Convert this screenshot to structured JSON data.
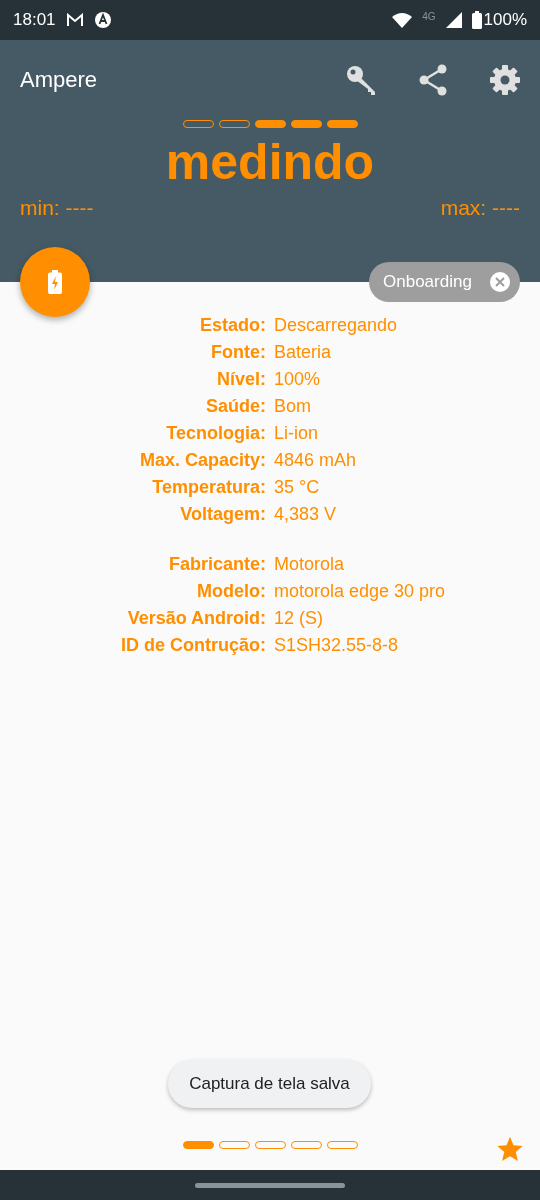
{
  "status_bar": {
    "time": "18:01",
    "network": "4G",
    "battery": "100%"
  },
  "app_bar": {
    "title": "Ampere"
  },
  "meter": {
    "segments": [
      {
        "on": false
      },
      {
        "on": false
      },
      {
        "on": true
      },
      {
        "on": true
      },
      {
        "on": true
      }
    ],
    "status": "medindo",
    "min": "min: ----",
    "max": "max: ----"
  },
  "chip": {
    "label": "Onboarding"
  },
  "info_groups": [
    {
      "rows": [
        {
          "label": "Estado:",
          "value": "Descarregando"
        },
        {
          "label": "Fonte:",
          "value": "Bateria"
        },
        {
          "label": "Nível:",
          "value": "100%"
        },
        {
          "label": "Saúde:",
          "value": "Bom"
        },
        {
          "label": "Tecnologia:",
          "value": "Li-ion"
        },
        {
          "label": "Max. Capacity:",
          "value": "4846 mAh"
        },
        {
          "label": "Temperatura:",
          "value": "35 °C"
        },
        {
          "label": "Voltagem:",
          "value": "4,383 V"
        }
      ]
    },
    {
      "rows": [
        {
          "label": "Fabricante:",
          "value": "Motorola"
        },
        {
          "label": "Modelo:",
          "value": "motorola edge 30 pro"
        },
        {
          "label": "Versão Android:",
          "value": "12 (S)"
        },
        {
          "label": "ID de Contrução:",
          "value": "S1SH32.55-8-8"
        }
      ]
    }
  ],
  "toast": "Captura de tela salva",
  "pager": [
    {
      "selected": true
    },
    {
      "selected": false
    },
    {
      "selected": false
    },
    {
      "selected": false
    },
    {
      "selected": false
    }
  ]
}
